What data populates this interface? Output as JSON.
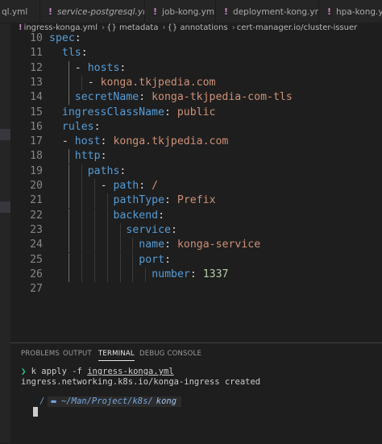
{
  "tabs": [
    {
      "name": "ql.yml",
      "italic": false,
      "modified_marker": ""
    },
    {
      "name": "service-postgresql.yml",
      "italic": true,
      "modified_marker": "!"
    },
    {
      "name": "job-kong.yml",
      "italic": false,
      "modified_marker": "!"
    },
    {
      "name": "deployment-kong.yml",
      "italic": false,
      "modified_marker": "!"
    },
    {
      "name": "hpa-kong.yml",
      "italic": false,
      "modified_marker": "!"
    }
  ],
  "breadcrumb": {
    "marker": "!",
    "file": "ingress-konga.yml",
    "items": [
      "{} metadata",
      "{} annotations",
      "cert-manager.io/cluster-issuer"
    ]
  },
  "editor": {
    "lines": [
      {
        "n": "10",
        "tokens": [
          {
            "t": "spec",
            "c": "key"
          },
          {
            "t": ":",
            "c": "punc"
          }
        ]
      },
      {
        "n": "11",
        "tokens": [
          {
            "t": "tls",
            "c": "key"
          },
          {
            "t": ":",
            "c": "punc"
          }
        ]
      },
      {
        "n": "12",
        "tokens": [
          {
            "t": "- ",
            "c": "punc"
          },
          {
            "t": "hosts",
            "c": "key"
          },
          {
            "t": ":",
            "c": "punc"
          }
        ]
      },
      {
        "n": "13",
        "tokens": [
          {
            "t": "- ",
            "c": "punc"
          },
          {
            "t": "konga.tkjpedia.com",
            "c": "val"
          }
        ]
      },
      {
        "n": "14",
        "tokens": [
          {
            "t": "secretName",
            "c": "key"
          },
          {
            "t": ": ",
            "c": "punc"
          },
          {
            "t": "konga-tkjpedia-com-tls",
            "c": "val"
          }
        ]
      },
      {
        "n": "15",
        "tokens": [
          {
            "t": "ingressClassName",
            "c": "key"
          },
          {
            "t": ": ",
            "c": "punc"
          },
          {
            "t": "public",
            "c": "val"
          }
        ]
      },
      {
        "n": "16",
        "tokens": [
          {
            "t": "rules",
            "c": "key"
          },
          {
            "t": ":",
            "c": "punc"
          }
        ]
      },
      {
        "n": "17",
        "tokens": [
          {
            "t": "- ",
            "c": "punc"
          },
          {
            "t": "host",
            "c": "key"
          },
          {
            "t": ": ",
            "c": "punc"
          },
          {
            "t": "konga.tkjpedia.com",
            "c": "val"
          }
        ]
      },
      {
        "n": "18",
        "tokens": [
          {
            "t": "http",
            "c": "key"
          },
          {
            "t": ":",
            "c": "punc"
          }
        ]
      },
      {
        "n": "19",
        "tokens": [
          {
            "t": "paths",
            "c": "key"
          },
          {
            "t": ":",
            "c": "punc"
          }
        ]
      },
      {
        "n": "20",
        "tokens": [
          {
            "t": "- ",
            "c": "punc"
          },
          {
            "t": "path",
            "c": "key"
          },
          {
            "t": ": ",
            "c": "punc"
          },
          {
            "t": "/",
            "c": "val"
          }
        ]
      },
      {
        "n": "21",
        "tokens": [
          {
            "t": "pathType",
            "c": "key"
          },
          {
            "t": ": ",
            "c": "punc"
          },
          {
            "t": "Prefix",
            "c": "val"
          }
        ]
      },
      {
        "n": "22",
        "tokens": [
          {
            "t": "backend",
            "c": "key"
          },
          {
            "t": ":",
            "c": "punc"
          }
        ]
      },
      {
        "n": "23",
        "tokens": [
          {
            "t": "service",
            "c": "key"
          },
          {
            "t": ":",
            "c": "punc"
          }
        ]
      },
      {
        "n": "24",
        "tokens": [
          {
            "t": "name",
            "c": "key"
          },
          {
            "t": ": ",
            "c": "punc"
          },
          {
            "t": "konga-service",
            "c": "val"
          }
        ]
      },
      {
        "n": "25",
        "tokens": [
          {
            "t": "port",
            "c": "key"
          },
          {
            "t": ":",
            "c": "punc"
          }
        ]
      },
      {
        "n": "26",
        "tokens": [
          {
            "t": "number",
            "c": "key"
          },
          {
            "t": ": ",
            "c": "punc"
          },
          {
            "t": "1337",
            "c": "num"
          }
        ]
      },
      {
        "n": "27",
        "tokens": []
      }
    ]
  },
  "panel": {
    "tabs": [
      "PROBLEMS",
      "OUTPUT",
      "TERMINAL",
      "DEBUG CONSOLE"
    ],
    "active_tab": "TERMINAL"
  },
  "terminal": {
    "prompt_char": "❯",
    "command_prefix": "k apply -f ",
    "command_file": "ingress-konga.yml",
    "output": "ingress.networking.k8s.io/konga-ingress created",
    "prompt_segments": {
      "os": "",
      "sep": "/",
      "folder_icon": "▬",
      "path": "~/Man/Project/k8s/",
      "dir": "kong"
    }
  },
  "colors": {
    "key": "#569cd6",
    "string": "#ce9178",
    "number": "#b5cea8",
    "prompt": "#23d18b"
  }
}
